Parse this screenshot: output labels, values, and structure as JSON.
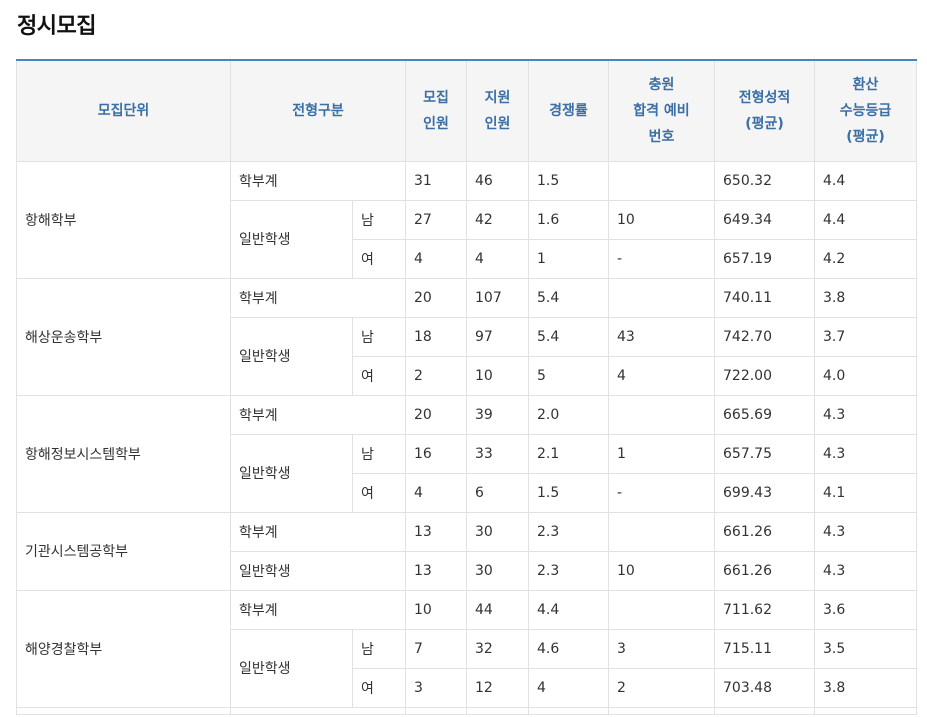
{
  "page_title": "정시모집",
  "headers": {
    "unit": "모집단위",
    "type": "전형구분",
    "quota": [
      "모집",
      "인원"
    ],
    "applicants": [
      "지원",
      "인원"
    ],
    "ratio": "경쟁률",
    "waitlist": [
      "충원",
      "합격 예비",
      "번호"
    ],
    "score": [
      "전형성적",
      "(평균)"
    ],
    "grade": [
      "환산",
      "수능등급",
      "(평균)"
    ]
  },
  "rows": [
    {
      "unit": "항해학부",
      "type": "학부계",
      "gender": "",
      "quota": "31",
      "applicants": "46",
      "ratio": "1.5",
      "waitlist": "",
      "score": "650.32",
      "grade": "4.4"
    },
    {
      "unit": "",
      "type": "일반학생",
      "gender": "남",
      "quota": "27",
      "applicants": "42",
      "ratio": "1.6",
      "waitlist": "10",
      "score": "649.34",
      "grade": "4.4"
    },
    {
      "unit": "",
      "type": "",
      "gender": "여",
      "quota": "4",
      "applicants": "4",
      "ratio": "1",
      "waitlist": "-",
      "score": "657.19",
      "grade": "4.2"
    },
    {
      "unit": "해상운송학부",
      "type": "학부계",
      "gender": "",
      "quota": "20",
      "applicants": "107",
      "ratio": "5.4",
      "waitlist": "",
      "score": "740.11",
      "grade": "3.8"
    },
    {
      "unit": "",
      "type": "일반학생",
      "gender": "남",
      "quota": "18",
      "applicants": "97",
      "ratio": "5.4",
      "waitlist": "43",
      "score": "742.70",
      "grade": "3.7"
    },
    {
      "unit": "",
      "type": "",
      "gender": "여",
      "quota": "2",
      "applicants": "10",
      "ratio": "5",
      "waitlist": "4",
      "score": "722.00",
      "grade": "4.0"
    },
    {
      "unit": "항해정보시스템학부",
      "type": "학부계",
      "gender": "",
      "quota": "20",
      "applicants": "39",
      "ratio": "2.0",
      "waitlist": "",
      "score": "665.69",
      "grade": "4.3"
    },
    {
      "unit": "",
      "type": "일반학생",
      "gender": "남",
      "quota": "16",
      "applicants": "33",
      "ratio": "2.1",
      "waitlist": "1",
      "score": "657.75",
      "grade": "4.3"
    },
    {
      "unit": "",
      "type": "",
      "gender": "여",
      "quota": "4",
      "applicants": "6",
      "ratio": "1.5",
      "waitlist": "-",
      "score": "699.43",
      "grade": "4.1"
    },
    {
      "unit": "기관시스템공학부",
      "type": "학부계",
      "gender": "",
      "quota": "13",
      "applicants": "30",
      "ratio": "2.3",
      "waitlist": "",
      "score": "661.26",
      "grade": "4.3"
    },
    {
      "unit": "",
      "type": "일반학생",
      "gender": "",
      "quota": "13",
      "applicants": "30",
      "ratio": "2.3",
      "waitlist": "10",
      "score": "661.26",
      "grade": "4.3"
    },
    {
      "unit": "해양경찰학부",
      "type": "학부계",
      "gender": "",
      "quota": "10",
      "applicants": "44",
      "ratio": "4.4",
      "waitlist": "",
      "score": "711.62",
      "grade": "3.6"
    },
    {
      "unit": "",
      "type": "일반학생",
      "gender": "남",
      "quota": "7",
      "applicants": "32",
      "ratio": "4.6",
      "waitlist": "3",
      "score": "715.11",
      "grade": "3.5"
    },
    {
      "unit": "",
      "type": "",
      "gender": "여",
      "quota": "3",
      "applicants": "12",
      "ratio": "4",
      "waitlist": "2",
      "score": "703.48",
      "grade": "3.8"
    }
  ]
}
